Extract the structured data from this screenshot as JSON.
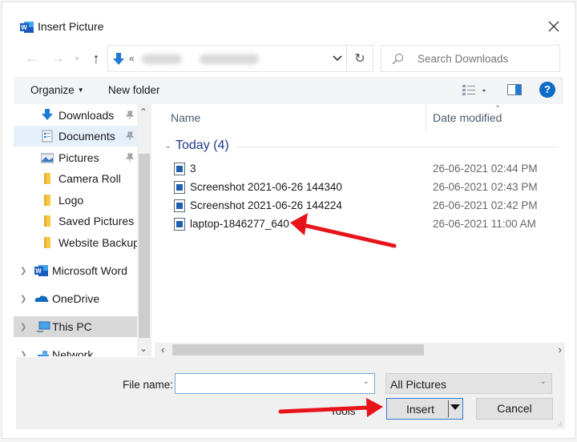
{
  "window": {
    "title": "Insert Picture",
    "app_icon": "word-icon",
    "close_icon": "close-icon"
  },
  "nav": {
    "back_icon": "arrow-left-icon",
    "forward_icon": "arrow-right-icon",
    "recent_icon": "chevron-down-icon",
    "up_icon": "arrow-up-icon",
    "address_prefix": "«",
    "address_path_blurred": true,
    "refresh_icon": "refresh-icon",
    "search_placeholder": "Search Downloads"
  },
  "toolbar": {
    "organize_label": "Organize",
    "new_folder_label": "New folder",
    "help_label": "?"
  },
  "sidebar": {
    "items": [
      {
        "label": "Downloads",
        "icon": "downloads-icon",
        "pinned": true
      },
      {
        "label": "Documents",
        "icon": "documents-icon",
        "pinned": true,
        "selected": true
      },
      {
        "label": "Pictures",
        "icon": "pictures-icon",
        "pinned": true
      },
      {
        "label": "Camera Roll",
        "icon": "folder-icon"
      },
      {
        "label": "Logo",
        "icon": "folder-icon"
      },
      {
        "label": "Saved Pictures",
        "icon": "folder-icon"
      },
      {
        "label": "Website Backup",
        "icon": "folder-icon"
      },
      {
        "label": "Microsoft Word",
        "icon": "word-icon",
        "expandable": true
      },
      {
        "label": "OneDrive",
        "icon": "onedrive-icon",
        "expandable": true
      },
      {
        "label": "This PC",
        "icon": "this-pc-icon",
        "expandable": true,
        "highlighted": true
      },
      {
        "label": "Network",
        "icon": "network-icon",
        "expandable": true
      }
    ]
  },
  "filelist": {
    "columns": [
      "Name",
      "Date modified"
    ],
    "group": {
      "title": "Today (4)"
    },
    "files": [
      {
        "name": "3",
        "date": "26-06-2021 02:44 PM"
      },
      {
        "name": "Screenshot 2021-06-26 144340",
        "date": "26-06-2021 02:43 PM"
      },
      {
        "name": "Screenshot 2021-06-26 144224",
        "date": "26-06-2021 02:42 PM"
      },
      {
        "name": "laptop-1846277_640",
        "date": "26-06-2021 11:00 AM"
      }
    ]
  },
  "footer": {
    "file_name_label": "File name:",
    "file_name_value": "",
    "file_type_value": "All Pictures",
    "tools_label": "Tools",
    "insert_label": "Insert",
    "cancel_label": "Cancel"
  },
  "annotations": {
    "arrow_color": "#e8141b",
    "arrows": [
      "points-to-laptop-file",
      "points-to-insert-button"
    ]
  },
  "colors": {
    "accent": "#0c6ac8",
    "selection": "#e5f0fb",
    "group_title": "#1e3a8a"
  }
}
